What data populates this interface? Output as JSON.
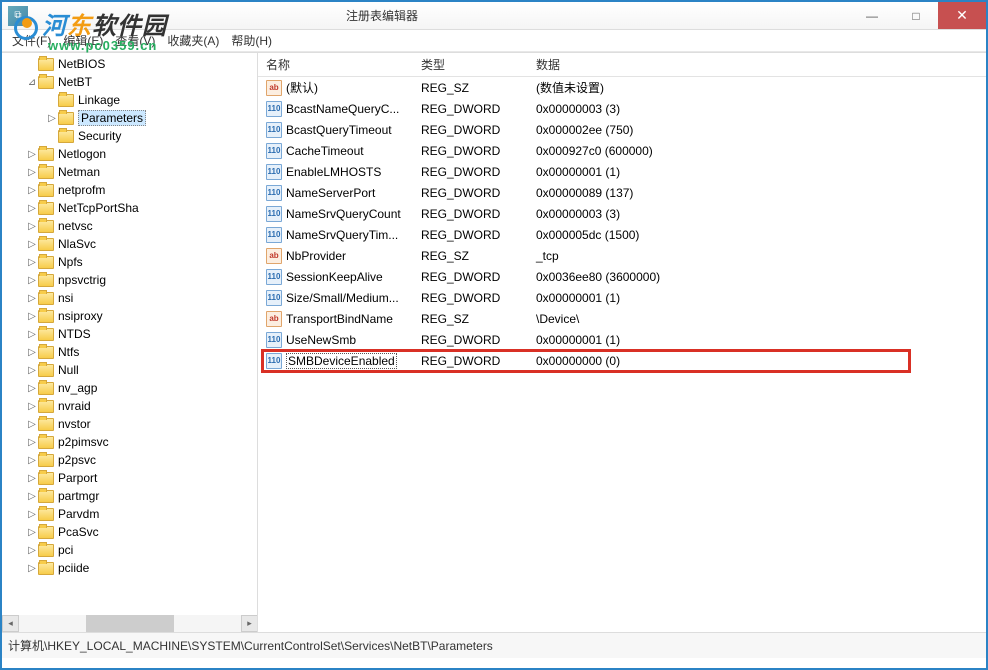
{
  "window": {
    "title": "注册表编辑器",
    "min": "—",
    "max": "□",
    "close": "✕",
    "icon_glyph": "⧉"
  },
  "menu": {
    "file": "文件(F)",
    "edit": "编辑(E)",
    "view": "查看(V)",
    "favorites": "收藏夹(A)",
    "help": "帮助(H)"
  },
  "tree": {
    "items": [
      {
        "depth": 1,
        "exp": "",
        "label": "NetBIOS"
      },
      {
        "depth": 1,
        "exp": "⊿",
        "label": "NetBT"
      },
      {
        "depth": 2,
        "exp": "",
        "label": "Linkage"
      },
      {
        "depth": 2,
        "exp": "▷",
        "label": "Parameters",
        "selected": true
      },
      {
        "depth": 2,
        "exp": "",
        "label": "Security"
      },
      {
        "depth": 1,
        "exp": "▷",
        "label": "Netlogon"
      },
      {
        "depth": 1,
        "exp": "▷",
        "label": "Netman"
      },
      {
        "depth": 1,
        "exp": "▷",
        "label": "netprofm"
      },
      {
        "depth": 1,
        "exp": "▷",
        "label": "NetTcpPortSha"
      },
      {
        "depth": 1,
        "exp": "▷",
        "label": "netvsc"
      },
      {
        "depth": 1,
        "exp": "▷",
        "label": "NlaSvc"
      },
      {
        "depth": 1,
        "exp": "▷",
        "label": "Npfs"
      },
      {
        "depth": 1,
        "exp": "▷",
        "label": "npsvctrig"
      },
      {
        "depth": 1,
        "exp": "▷",
        "label": "nsi"
      },
      {
        "depth": 1,
        "exp": "▷",
        "label": "nsiproxy"
      },
      {
        "depth": 1,
        "exp": "▷",
        "label": "NTDS"
      },
      {
        "depth": 1,
        "exp": "▷",
        "label": "Ntfs"
      },
      {
        "depth": 1,
        "exp": "▷",
        "label": "Null"
      },
      {
        "depth": 1,
        "exp": "▷",
        "label": "nv_agp"
      },
      {
        "depth": 1,
        "exp": "▷",
        "label": "nvraid"
      },
      {
        "depth": 1,
        "exp": "▷",
        "label": "nvstor"
      },
      {
        "depth": 1,
        "exp": "▷",
        "label": "p2pimsvc"
      },
      {
        "depth": 1,
        "exp": "▷",
        "label": "p2psvc"
      },
      {
        "depth": 1,
        "exp": "▷",
        "label": "Parport"
      },
      {
        "depth": 1,
        "exp": "▷",
        "label": "partmgr"
      },
      {
        "depth": 1,
        "exp": "▷",
        "label": "Parvdm"
      },
      {
        "depth": 1,
        "exp": "▷",
        "label": "PcaSvc"
      },
      {
        "depth": 1,
        "exp": "▷",
        "label": "pci"
      },
      {
        "depth": 1,
        "exp": "▷",
        "label": "pciide"
      }
    ]
  },
  "list": {
    "headers": {
      "name": "名称",
      "type": "类型",
      "data": "数据"
    },
    "rows": [
      {
        "icon": "sz",
        "icon_txt": "ab",
        "name": "(默认)",
        "type": "REG_SZ",
        "data": "(数值未设置)"
      },
      {
        "icon": "dw",
        "icon_txt": "110",
        "name": "BcastNameQueryC...",
        "type": "REG_DWORD",
        "data": "0x00000003 (3)"
      },
      {
        "icon": "dw",
        "icon_txt": "110",
        "name": "BcastQueryTimeout",
        "type": "REG_DWORD",
        "data": "0x000002ee (750)"
      },
      {
        "icon": "dw",
        "icon_txt": "110",
        "name": "CacheTimeout",
        "type": "REG_DWORD",
        "data": "0x000927c0 (600000)"
      },
      {
        "icon": "dw",
        "icon_txt": "110",
        "name": "EnableLMHOSTS",
        "type": "REG_DWORD",
        "data": "0x00000001 (1)"
      },
      {
        "icon": "dw",
        "icon_txt": "110",
        "name": "NameServerPort",
        "type": "REG_DWORD",
        "data": "0x00000089 (137)"
      },
      {
        "icon": "dw",
        "icon_txt": "110",
        "name": "NameSrvQueryCount",
        "type": "REG_DWORD",
        "data": "0x00000003 (3)"
      },
      {
        "icon": "dw",
        "icon_txt": "110",
        "name": "NameSrvQueryTim...",
        "type": "REG_DWORD",
        "data": "0x000005dc (1500)"
      },
      {
        "icon": "sz",
        "icon_txt": "ab",
        "name": "NbProvider",
        "type": "REG_SZ",
        "data": "_tcp"
      },
      {
        "icon": "dw",
        "icon_txt": "110",
        "name": "SessionKeepAlive",
        "type": "REG_DWORD",
        "data": "0x0036ee80 (3600000)"
      },
      {
        "icon": "dw",
        "icon_txt": "110",
        "name": "Size/Small/Medium...",
        "type": "REG_DWORD",
        "data": "0x00000001 (1)"
      },
      {
        "icon": "sz",
        "icon_txt": "ab",
        "name": "TransportBindName",
        "type": "REG_SZ",
        "data": "\\Device\\"
      },
      {
        "icon": "dw",
        "icon_txt": "110",
        "name": "UseNewSmb",
        "type": "REG_DWORD",
        "data": "0x00000001 (1)"
      },
      {
        "icon": "dw",
        "icon_txt": "110",
        "name": "SMBDeviceEnabled",
        "type": "REG_DWORD",
        "data": "0x00000000 (0)",
        "boxed": true,
        "highlighted": true
      }
    ]
  },
  "statusbar": {
    "path": "计算机\\HKEY_LOCAL_MACHINE\\SYSTEM\\CurrentControlSet\\Services\\NetBT\\Parameters"
  },
  "watermark": {
    "line1_a": "河",
    "line1_b": "东",
    "line1_c": "软件园",
    "line2": "www.pc0359.cn"
  }
}
